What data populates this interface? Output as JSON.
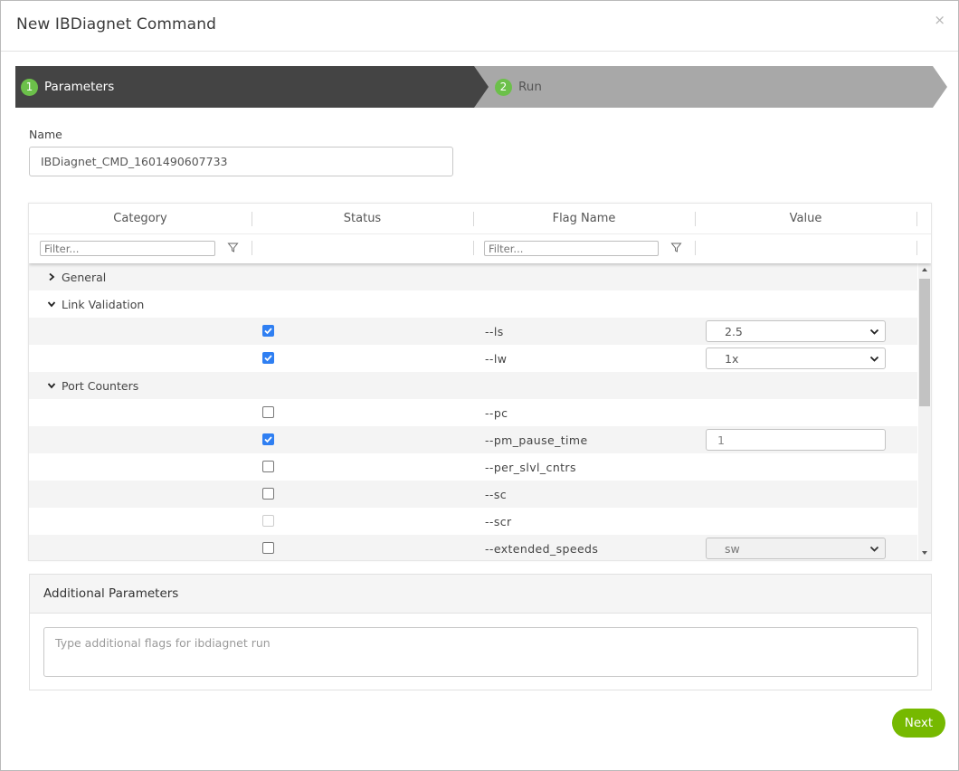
{
  "dialog": {
    "title": "New IBDiagnet Command",
    "close_label": "×"
  },
  "wizard": {
    "steps": [
      {
        "number": "1",
        "label": "Parameters",
        "active": true
      },
      {
        "number": "2",
        "label": "Run",
        "active": false
      }
    ]
  },
  "name_field": {
    "label": "Name",
    "value": "IBDiagnet_CMD_1601490607733"
  },
  "table": {
    "columns": [
      "Category",
      "Status",
      "Flag Name",
      "Value"
    ],
    "filter_placeholder": "Filter...",
    "groups": [
      {
        "label": "General",
        "expanded": false
      },
      {
        "label": "Link Validation",
        "expanded": true
      },
      {
        "label": "Port Counters",
        "expanded": true
      }
    ],
    "rows": [
      {
        "flag": "--ls",
        "checked": true,
        "value": "2.5",
        "value_type": "select"
      },
      {
        "flag": "--lw",
        "checked": true,
        "value": "1x",
        "value_type": "select"
      },
      {
        "flag": "--pc",
        "checked": false,
        "value": "",
        "value_type": "none"
      },
      {
        "flag": "--pm_pause_time",
        "checked": true,
        "value": "1",
        "value_type": "input"
      },
      {
        "flag": "--per_slvl_cntrs",
        "checked": false,
        "value": "",
        "value_type": "none"
      },
      {
        "flag": "--sc",
        "checked": false,
        "value": "",
        "value_type": "none"
      },
      {
        "flag": "--scr",
        "checked": false,
        "disabled": true,
        "value": "",
        "value_type": "none"
      },
      {
        "flag": "--extended_speeds",
        "checked": false,
        "value": "sw",
        "value_type": "select-disabled"
      }
    ]
  },
  "additional": {
    "title": "Additional Parameters",
    "placeholder": "Type additional flags for ibdiagnet run"
  },
  "actions": {
    "next_label": "Next"
  },
  "colors": {
    "step_active_bg": "#444444",
    "step_inactive_bg": "#a8a8a8",
    "step_badge": "#6cc04a",
    "checkbox_checked": "#2f7ff2",
    "next_button": "#76b900"
  }
}
